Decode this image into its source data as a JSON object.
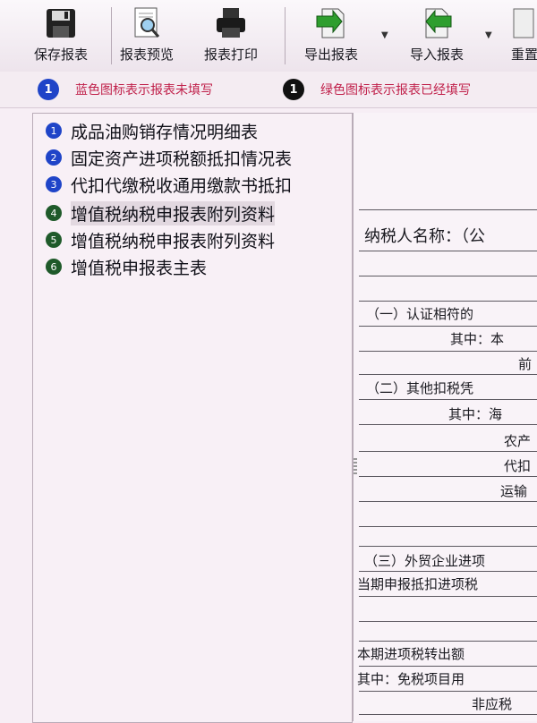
{
  "toolbar": {
    "save": "保存报表",
    "preview": "报表预览",
    "print": "报表打印",
    "export": "导出报表",
    "import": "导入报表",
    "reset": "重置"
  },
  "legend": {
    "blue_badge": "1",
    "blue_text": "蓝色图标表示报表未填写",
    "green_badge": "1",
    "green_text": "绿色图标表示报表已经填写",
    "blue_color": "#1f44c8",
    "green_color": "#1f5a2a"
  },
  "reports": [
    {
      "num": "1",
      "label": "成品油购销存情况明细表",
      "status": "blue"
    },
    {
      "num": "2",
      "label": "固定资产进项税额抵扣情况表",
      "status": "blue"
    },
    {
      "num": "3",
      "label": "代扣代缴税收通用缴款书抵扣",
      "status": "blue"
    },
    {
      "num": "4",
      "label": "增值税纳税申报表附列资料",
      "status": "green"
    },
    {
      "num": "5",
      "label": "增值税纳税申报表附列资料",
      "status": "green"
    },
    {
      "num": "6",
      "label": "增值税申报表主表",
      "status": "green"
    }
  ],
  "form": {
    "taxpayer": "纳税人名称：（公",
    "sec1": "（一）认证相符的",
    "sec1_sub1": "其中：本",
    "sec1_sub2": "前",
    "sec2": "（二）其他扣税凭",
    "sec2_sub1": "其中：海",
    "sec2_sub2": "农产",
    "sec2_sub3": "代扣",
    "sec2_sub4": "运输",
    "sec3": "（三）外贸企业进项",
    "current": "当期申报抵扣进项税",
    "transfer": "本期进项税转出额",
    "exempt": "其中：免税项目用",
    "nontax": "非应税"
  }
}
